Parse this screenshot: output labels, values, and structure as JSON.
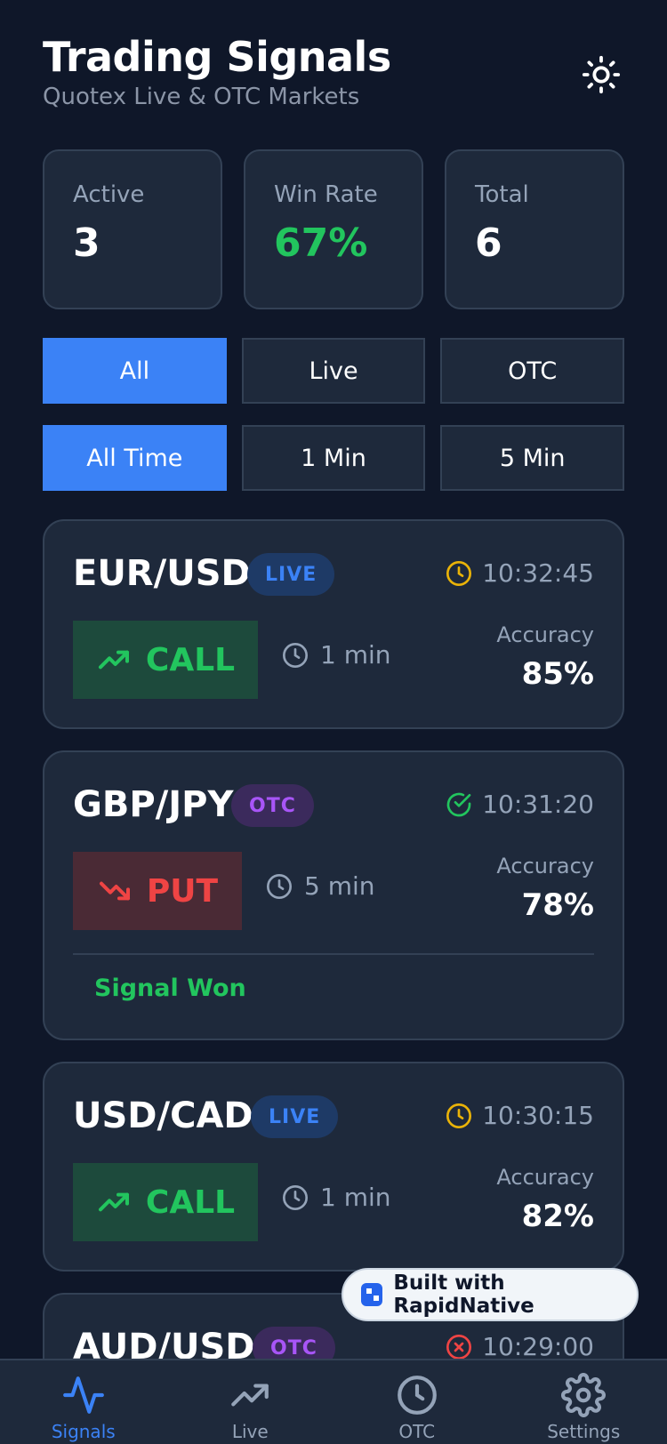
{
  "header": {
    "title": "Trading Signals",
    "subtitle": "Quotex Live & OTC Markets"
  },
  "stats": [
    {
      "label": "Active",
      "value": "3"
    },
    {
      "label": "Win Rate",
      "value": "67%"
    },
    {
      "label": "Total",
      "value": "6"
    }
  ],
  "market_filters": [
    "All",
    "Live",
    "OTC"
  ],
  "active_market_filter": "All",
  "time_filters": [
    "All Time",
    "1 Min",
    "5 Min"
  ],
  "active_time_filter": "All Time",
  "accuracy_label": "Accuracy",
  "signals": [
    {
      "pair": "EUR/USD",
      "market": "LIVE",
      "status_icon": "clock-icon",
      "time": "10:32:45",
      "direction": "CALL",
      "duration": "1 min",
      "accuracy": "85%"
    },
    {
      "pair": "GBP/JPY",
      "market": "OTC",
      "status_icon": "check-circle-icon",
      "time": "10:31:20",
      "direction": "PUT",
      "duration": "5 min",
      "accuracy": "78%",
      "result": "Signal Won"
    },
    {
      "pair": "USD/CAD",
      "market": "LIVE",
      "status_icon": "clock-icon",
      "time": "10:30:15",
      "direction": "CALL",
      "duration": "1 min",
      "accuracy": "82%"
    },
    {
      "pair": "AUD/USD",
      "market": "OTC",
      "status_icon": "x-circle-icon",
      "time": "10:29:00"
    }
  ],
  "built_with": "Built with RapidNative",
  "nav": [
    {
      "label": "Signals",
      "icon": "activity-icon",
      "active": true
    },
    {
      "label": "Live",
      "icon": "trending-up-icon",
      "active": false
    },
    {
      "label": "OTC",
      "icon": "clock-icon",
      "active": false
    },
    {
      "label": "Settings",
      "icon": "gear-icon",
      "active": false
    }
  ],
  "colors": {
    "background": "#0f1729",
    "card": "#1e293b",
    "border": "#334155",
    "accent": "#3b82f6",
    "call": "#22c55e",
    "put": "#ef4444",
    "pending": "#eab308",
    "otc": "#a855f7"
  }
}
